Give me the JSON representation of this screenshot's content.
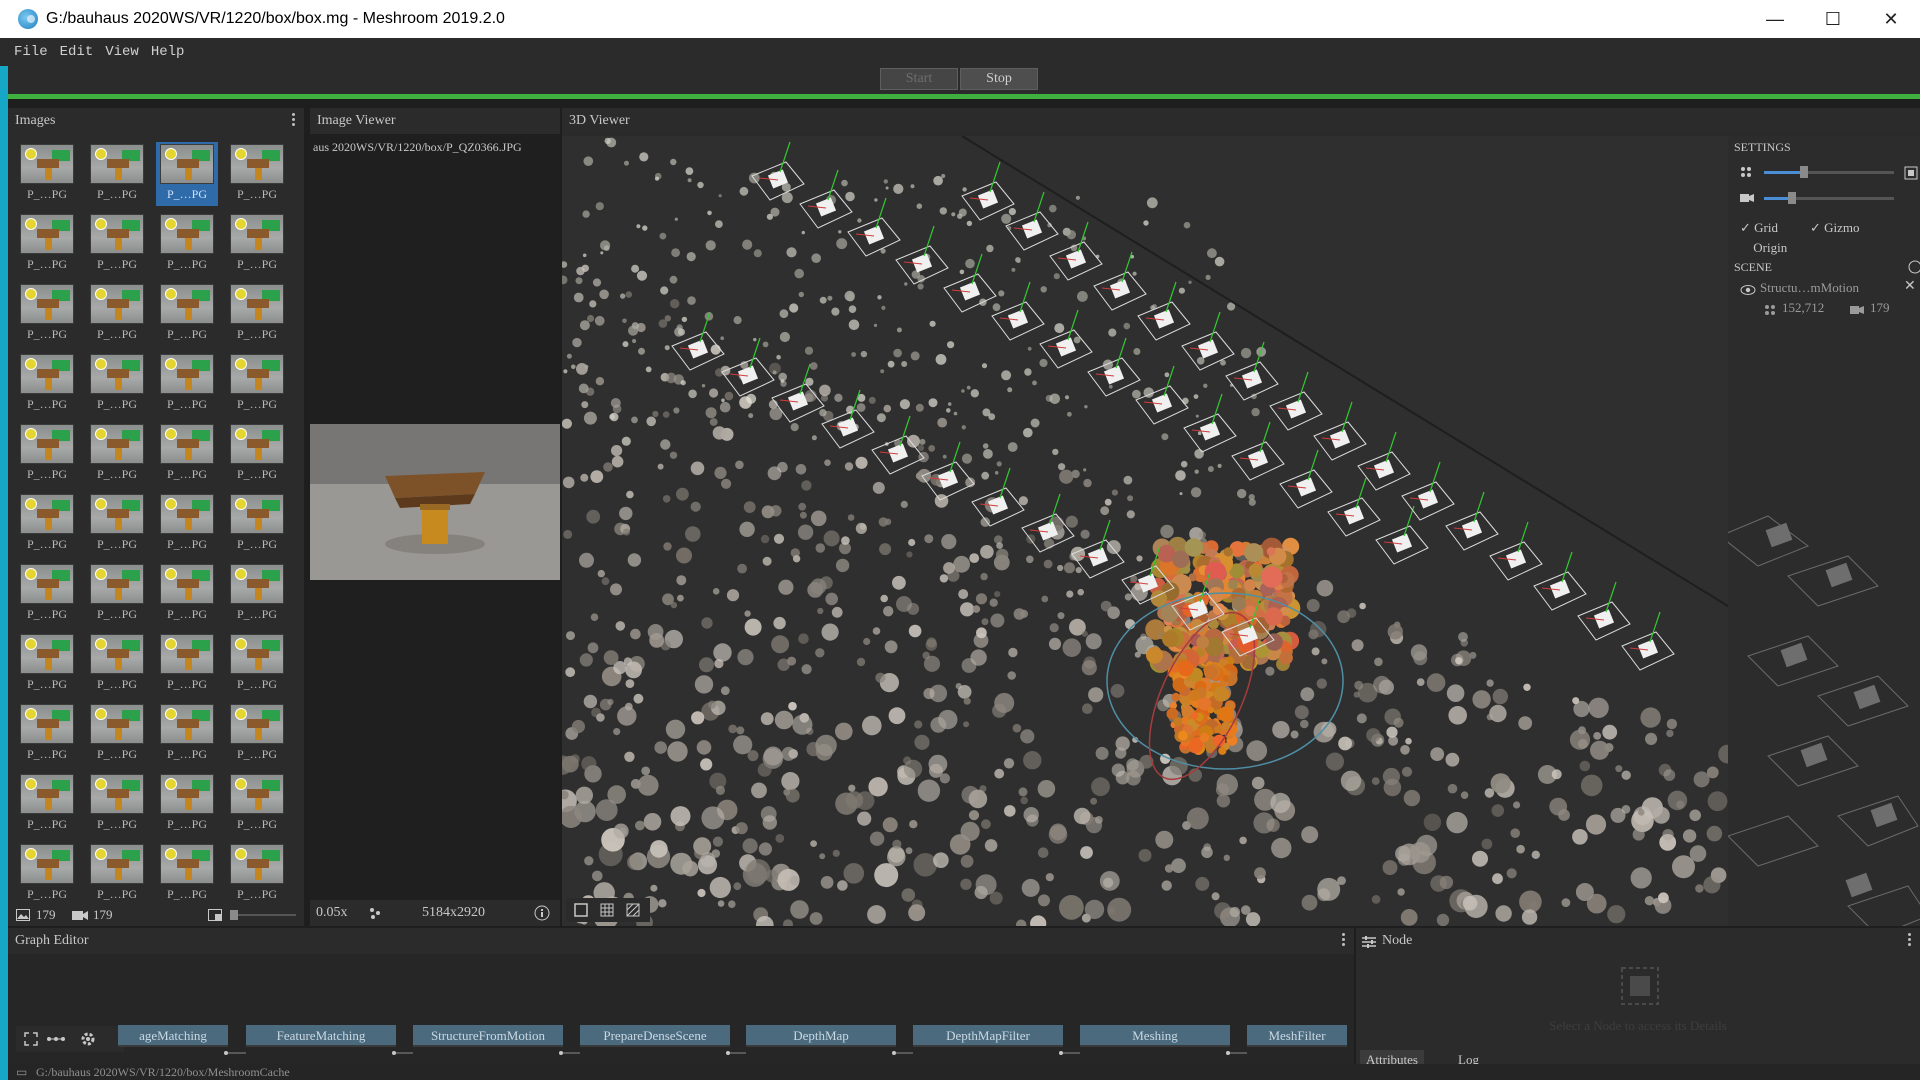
{
  "window": {
    "title": "G:/bauhaus 2020WS/VR/1220/box/box.mg - Meshroom 2019.2.0",
    "controls": [
      "—",
      "☐",
      "✕"
    ]
  },
  "menu": [
    "File",
    "Edit",
    "View",
    "Help"
  ],
  "toolbar": {
    "start_label": "Start",
    "stop_label": "Stop"
  },
  "images_panel": {
    "title": "Images",
    "thumb_label": "P_…PG",
    "selected_index": 2,
    "image_count": "179",
    "camera_count": "179"
  },
  "image_viewer": {
    "title": "Image Viewer",
    "path": "aus 2020WS/VR/1220/box/P_QZ0366.JPG",
    "zoom": "0.05x",
    "resolution": "5184x2920"
  },
  "viewer3d": {
    "title": "3D Viewer",
    "settings_title": "SETTINGS",
    "grid_label": "Grid",
    "gizmo_label": "Gizmo",
    "origin_label": "Origin",
    "scene_title": "SCENE",
    "scene_item": "Structu…mMotion",
    "points": "152,712",
    "cameras": "179"
  },
  "graph_editor": {
    "title": "Graph Editor",
    "nodes": [
      "ageMatching",
      "FeatureMatching",
      "StructureFromMotion",
      "PrepareDenseScene",
      "DepthMap",
      "DepthMapFilter",
      "Meshing",
      "MeshFilter"
    ]
  },
  "node_panel": {
    "title": "Node",
    "hint": "Select a Node to access its Details",
    "tabs": [
      "Attributes",
      "Log"
    ]
  },
  "statusbar": {
    "path": "G:/bauhaus 2020WS/VR/1220/box/MeshroomCache"
  },
  "colors": {
    "accent": "#3faf3f",
    "selection": "#2f6aa9",
    "node": "#4c6a7e"
  }
}
